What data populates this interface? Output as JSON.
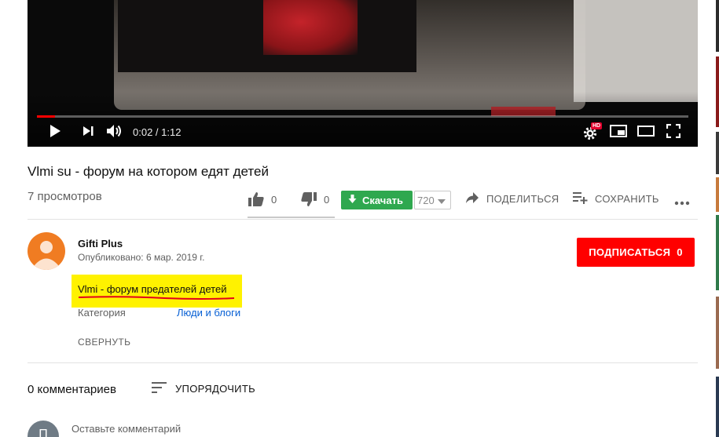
{
  "player": {
    "time_current": "0:02",
    "time_separator": " / ",
    "time_total": "1:12",
    "progress_fraction": 0.028,
    "hd_badge": "HD",
    "icons": [
      "play-icon",
      "next-icon",
      "volume-icon",
      "settings-icon",
      "miniplayer-icon",
      "theater-icon",
      "fullscreen-icon"
    ]
  },
  "video": {
    "title": "Vlmi su - форум на котором едят детей",
    "views": "7 просмотров"
  },
  "actions": {
    "likes": "0",
    "dislikes": "0",
    "download_label": "Скачать",
    "quality": "720",
    "share_label": "ПОДЕЛИТЬСЯ",
    "save_label": "СОХРАНИТЬ"
  },
  "channel": {
    "name": "Gifti Plus",
    "published": "Опубликовано: 6 мар. 2019 г.",
    "subscribe_label": "ПОДПИСАТЬСЯ",
    "subscriber_count": "0"
  },
  "description": {
    "text": "Vlmi - форум предателей детей",
    "highlight_color": "#fff200",
    "underline_color": "#e3001b"
  },
  "metadata": {
    "category_label": "Категория",
    "category_value": "Люди и блоги",
    "collapse_label": "СВЕРНУТЬ"
  },
  "comments": {
    "count_label": "0 комментариев",
    "sort_label": "УПОРЯДОЧИТЬ",
    "avatar_letter": "П",
    "placeholder": "Оставьте комментарий"
  },
  "colors": {
    "subscribe": "#ff0000",
    "download": "#2fa84f",
    "link": "#065fd4",
    "avatar": "#f07c22"
  }
}
